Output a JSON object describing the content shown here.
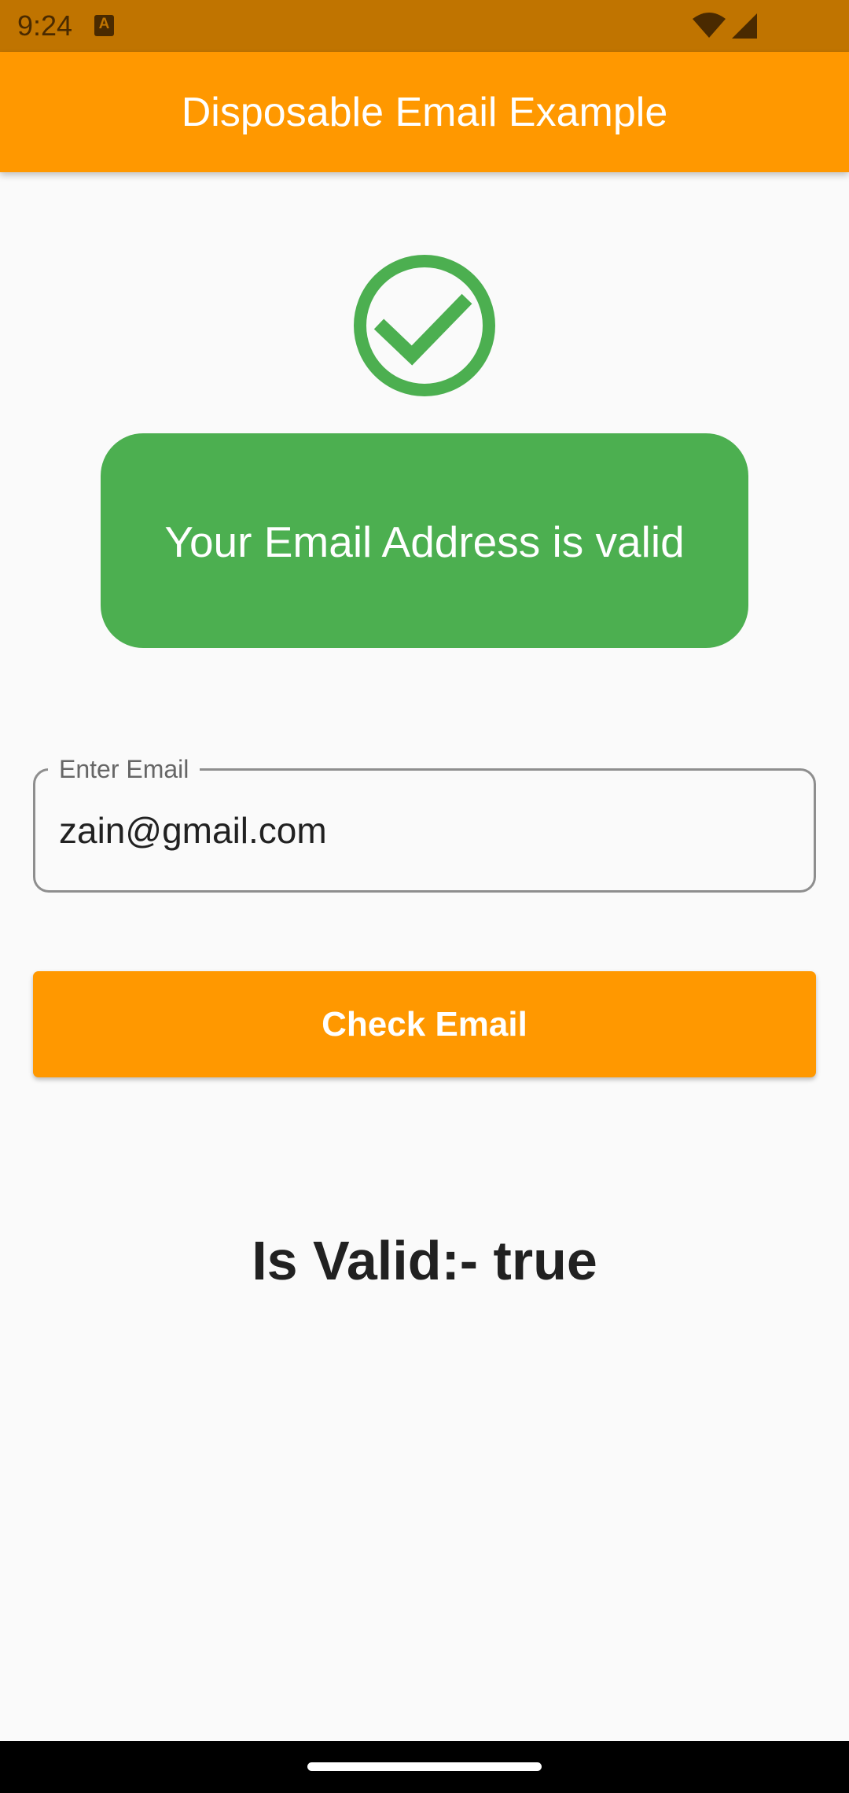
{
  "status_bar": {
    "time": "9:24",
    "notification_icon_letter": "A",
    "icons": [
      "wifi-icon",
      "cellular-signal-icon"
    ]
  },
  "app_bar": {
    "title": "Disposable Email Example"
  },
  "result_card": {
    "icon": "check-circle-icon",
    "message": "Your Email Address is valid"
  },
  "email_field": {
    "label": "Enter Email",
    "value": "zain@gmail.com"
  },
  "check_button": {
    "label": "Check Email"
  },
  "result": {
    "text": "Is Valid:- true"
  },
  "colors": {
    "app_bar": "#ff9800",
    "status_bar": "#c07400",
    "success": "#4caf50",
    "background": "#fafafa"
  }
}
